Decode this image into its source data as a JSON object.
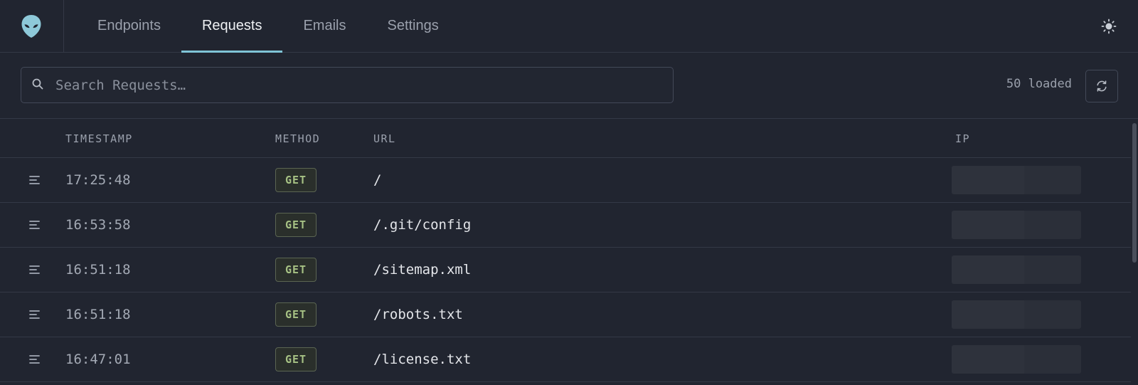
{
  "nav": {
    "tabs": [
      {
        "label": "Endpoints",
        "active": false
      },
      {
        "label": "Requests",
        "active": true
      },
      {
        "label": "Emails",
        "active": false
      },
      {
        "label": "Settings",
        "active": false
      }
    ]
  },
  "icons": {
    "logo": "alien-head-icon",
    "theme": "sun-icon",
    "search": "search-icon",
    "refresh": "refresh-icon",
    "row": "details-lines-icon"
  },
  "toolbar": {
    "search_placeholder": "Search Requests…",
    "loaded": "50 loaded"
  },
  "table": {
    "columns": {
      "timestamp": "TIMESTAMP",
      "method": "METHOD",
      "url": "URL",
      "ip": "IP"
    },
    "rows": [
      {
        "timestamp": "17:25:48",
        "method": "GET",
        "url": "/"
      },
      {
        "timestamp": "16:53:58",
        "method": "GET",
        "url": "/.git/config"
      },
      {
        "timestamp": "16:51:18",
        "method": "GET",
        "url": "/sitemap.xml"
      },
      {
        "timestamp": "16:51:18",
        "method": "GET",
        "url": "/robots.txt"
      },
      {
        "timestamp": "16:47:01",
        "method": "GET",
        "url": "/license.txt"
      }
    ]
  },
  "colors": {
    "background": "#212530",
    "accent": "#7fc4d6",
    "method_get": "#a6c184",
    "border": "#343946"
  }
}
